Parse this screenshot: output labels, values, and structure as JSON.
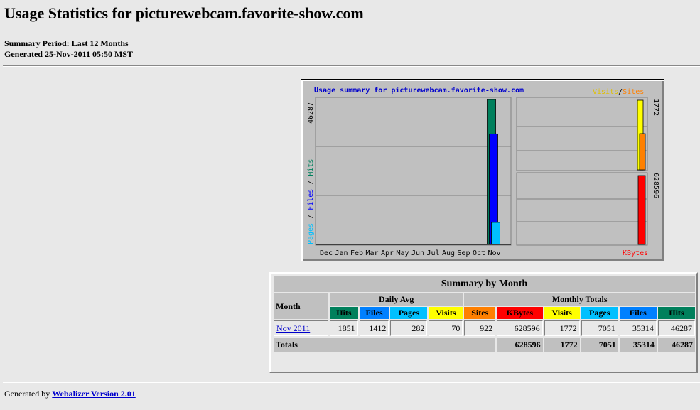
{
  "page": {
    "title": "Usage Statistics for picturewebcam.favorite-show.com",
    "summary_period": "Summary Period: Last 12 Months",
    "generated": "Generated 25-Nov-2011 05:50 MST"
  },
  "graph": {
    "title": "Usage summary for picturewebcam.favorite-show.com",
    "legend_visits": "Visits",
    "legend_sep": "/",
    "legend_sites": "Sites",
    "legend_kbytes": "KBytes",
    "left_axis_pages": "Pages",
    "left_axis_files": "Files",
    "left_axis_hits": "Hits",
    "left_max": "46287",
    "right_top_max": "1772",
    "right_bottom_max": "628596",
    "months": [
      "Dec",
      "Jan",
      "Feb",
      "Mar",
      "Apr",
      "May",
      "Jun",
      "Jul",
      "Aug",
      "Sep",
      "Oct",
      "Nov"
    ],
    "colors": {
      "hits": "#00805c",
      "files": "#0000ff",
      "pages": "#00c0ff",
      "visits": "#ffff00",
      "sites": "#ff8000",
      "kbytes": "#ff0000"
    }
  },
  "chart_data": {
    "type": "bar",
    "title": "Usage summary for picturewebcam.favorite-show.com",
    "categories": [
      "Dec",
      "Jan",
      "Feb",
      "Mar",
      "Apr",
      "May",
      "Jun",
      "Jul",
      "Aug",
      "Sep",
      "Oct",
      "Nov"
    ],
    "series": [
      {
        "name": "Hits",
        "values": [
          0,
          0,
          0,
          0,
          0,
          0,
          0,
          0,
          0,
          0,
          0,
          46287
        ]
      },
      {
        "name": "Files",
        "values": [
          0,
          0,
          0,
          0,
          0,
          0,
          0,
          0,
          0,
          0,
          0,
          35314
        ]
      },
      {
        "name": "Pages",
        "values": [
          0,
          0,
          0,
          0,
          0,
          0,
          0,
          0,
          0,
          0,
          0,
          7051
        ]
      },
      {
        "name": "Visits",
        "values": [
          0,
          0,
          0,
          0,
          0,
          0,
          0,
          0,
          0,
          0,
          0,
          1772
        ]
      },
      {
        "name": "Sites",
        "values": [
          0,
          0,
          0,
          0,
          0,
          0,
          0,
          0,
          0,
          0,
          0,
          922
        ]
      },
      {
        "name": "KBytes",
        "values": [
          0,
          0,
          0,
          0,
          0,
          0,
          0,
          0,
          0,
          0,
          0,
          628596
        ]
      }
    ]
  },
  "table": {
    "heading": "Summary by Month",
    "month_header": "Month",
    "daily_avg": "Daily Avg",
    "monthly_totals": "Monthly Totals",
    "col_hits": "Hits",
    "col_files": "Files",
    "col_pages": "Pages",
    "col_visits": "Visits",
    "col_sites": "Sites",
    "col_kbytes": "KBytes",
    "row": {
      "month": "Nov 2011",
      "avg_hits": "1851",
      "avg_files": "1412",
      "avg_pages": "282",
      "avg_visits": "70",
      "sites": "922",
      "kbytes": "628596",
      "visits": "1772",
      "pages": "7051",
      "files": "35314",
      "hits": "46287"
    },
    "totals": {
      "label": "Totals",
      "kbytes": "628596",
      "visits": "1772",
      "pages": "7051",
      "files": "35314",
      "hits": "46287"
    }
  },
  "footer": {
    "prefix": "Generated by ",
    "link": "Webalizer Version 2.01"
  }
}
